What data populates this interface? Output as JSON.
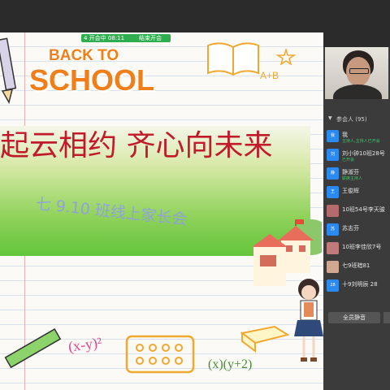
{
  "meeting": {
    "top_pill": "4  开会中 08:11",
    "top_pill2": "结束开会"
  },
  "slide": {
    "back_to": "BACK TO",
    "school": "SCHOOL",
    "title": "起云相约 齐心向未来",
    "subtitle": "七 9.10 班线上家长会",
    "math_ab": "A+B",
    "math_formula": "(x-y)²",
    "math_formula2": "(x)(y+2)"
  },
  "participants": {
    "header": "参会人 (95)",
    "members": [
      {
        "avatar": "我",
        "name": "我",
        "role": "主持人,主持人已开会",
        "avatar_color": "#2b8af0"
      },
      {
        "avatar": "刘",
        "name": "刘小钟10班28号",
        "role": "已开会",
        "avatar_color": "#2b8af0"
      },
      {
        "avatar": "静",
        "name": "静淑芬",
        "role": "联席主持人",
        "avatar_color": "#2b8af0"
      },
      {
        "avatar": "王",
        "name": "王俊辉",
        "role": "",
        "avatar_color": "#2b8af0"
      },
      {
        "avatar": "",
        "name": "10班54号李天骏",
        "role": "",
        "avatar_color": "#b56b6b"
      },
      {
        "avatar": "苏",
        "name": "苏志芬",
        "role": "",
        "avatar_color": "#2b8af0"
      },
      {
        "avatar": "",
        "name": "10班李佳欣7号",
        "role": "",
        "avatar_color": "#c07a7a"
      },
      {
        "avatar": "",
        "name": "七9班暗81",
        "role": "",
        "avatar_color": "#cfa88f"
      },
      {
        "avatar": "28",
        "name": "十9刘明辰 28",
        "role": "",
        "avatar_color": "#2b8af0"
      }
    ],
    "manage_button": "全员静音"
  }
}
